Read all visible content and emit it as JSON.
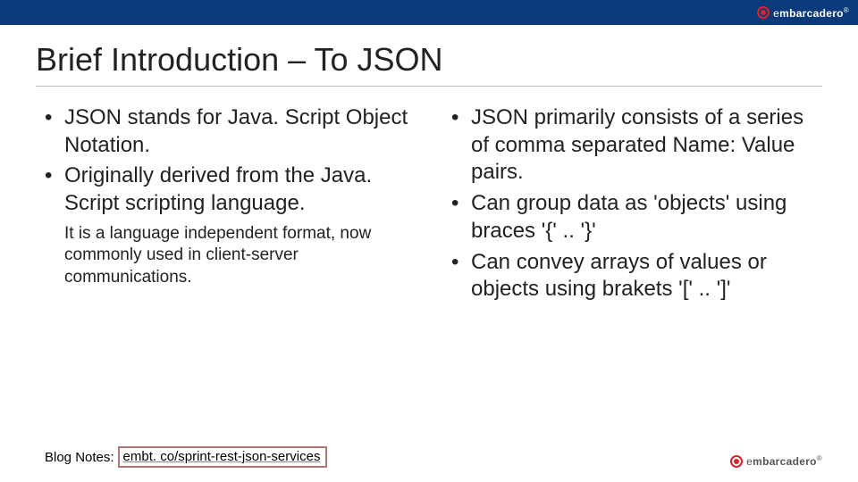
{
  "brand": {
    "prefix": "e",
    "bold": "mbarcadero",
    "reg": "®"
  },
  "title": "Brief Introduction – To JSON",
  "left": {
    "b1": "JSON stands for Java. Script Object Notation.",
    "b2": "Originally derived from the Java. Script scripting language.",
    "sub": "It is a language independent format, now commonly used in client-server communications."
  },
  "right": {
    "b1": "JSON primarily consists of a series of comma separated Name: Value pairs.",
    "b2": "Can group data as 'objects' using braces '{' .. '}'",
    "b3": "Can convey arrays of values or objects using brakets '[' .. ']'"
  },
  "footer": {
    "label": "Blog Notes:",
    "link": "embt. co/sprint-rest-json-services"
  }
}
